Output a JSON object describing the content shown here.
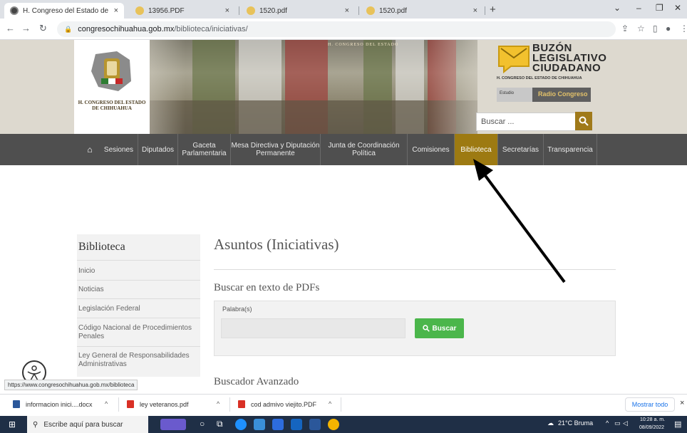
{
  "browser": {
    "tabs": [
      {
        "label": "H. Congreso del Estado de Chih...",
        "close": "×",
        "active": true
      },
      {
        "label": "13956.PDF",
        "close": "×",
        "active": false
      },
      {
        "label": "1520.pdf",
        "close": "×",
        "active": false
      },
      {
        "label": "1520.pdf",
        "close": "×",
        "active": false
      }
    ],
    "new_tab": "+",
    "url_host": "congresochihuahua.gob.mx",
    "url_path": "/biblioteca/iniciativas/",
    "window_controls": {
      "minimize": "–",
      "maximize": "❐",
      "close": "✕",
      "menu": "⌄"
    }
  },
  "header": {
    "logo_text_1": "H. CONGRESO DEL ESTADO",
    "logo_text_2": "DE CHIHUAHUA",
    "band_text": "H. CONGRESO DEL ESTADO",
    "buzon_lines": [
      "BUZÓN",
      "LEGISLATIVO",
      "CIUDADANO"
    ],
    "buzon_sub": "H. CONGRESO DEL ESTADO DE CHIHUAHUA",
    "radio_label": "Radio Congreso",
    "radio_left": "Estudio",
    "search_placeholder": "Buscar ..."
  },
  "nav": {
    "home_icon": "home-icon",
    "items": [
      {
        "label": "Sesiones"
      },
      {
        "label": "Diputados"
      },
      {
        "label": "Gaceta Parlamentaria"
      },
      {
        "label": "Mesa Directiva y Diputación Permanente"
      },
      {
        "label": "Junta de Coordinación Política"
      },
      {
        "label": "Comisiones"
      },
      {
        "label": "Biblioteca",
        "active": true
      },
      {
        "label": "Secretarías"
      },
      {
        "label": "Transparencia"
      }
    ],
    "active_color": "#9d7a12"
  },
  "sidebar": {
    "title": "Biblioteca",
    "items": [
      "Inicio",
      "Noticias",
      "Legislación Federal",
      "Código Nacional de Procedimientos Penales",
      "Ley General de Responsabilidades Administrativas"
    ]
  },
  "main": {
    "title": "Asuntos (Iniciativas)",
    "search_section": "Buscar en texto de PDFs",
    "field_label": "Palabra(s)",
    "button_label": "Buscar",
    "advanced_section": "Buscador Avanzado"
  },
  "status_url": "https://www.congresochihuahua.gob.mx/biblioteca",
  "downloads": {
    "items": [
      {
        "label": "informacion inici....docx",
        "type": "docx"
      },
      {
        "label": "ley veteranos.pdf",
        "type": "pdf"
      },
      {
        "label": "cod admivo viejito.PDF",
        "type": "pdf"
      }
    ],
    "show_all": "Mostrar todo",
    "close": "×"
  },
  "taskbar": {
    "search_placeholder": "Escribe aquí para buscar",
    "weather": "21°C Bruma",
    "time": "10:28 a. m.",
    "date": "08/09/2022"
  }
}
